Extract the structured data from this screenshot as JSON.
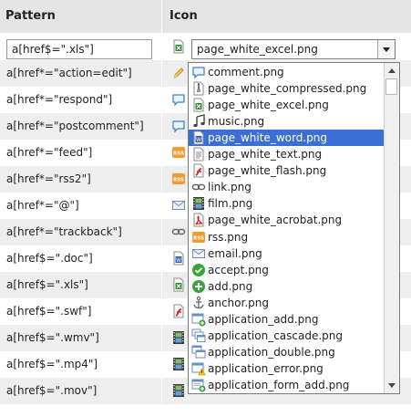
{
  "header": {
    "col1": "Pattern",
    "col2": "Icon"
  },
  "editor": {
    "pattern_value": "a[href$=\".xls\"]",
    "selected_icon": "page_white_excel.png",
    "selected_icon_name": "excel-icon"
  },
  "rows": [
    {
      "pattern": "a[href*=\"action=edit\"]",
      "icon": "pencil-icon"
    },
    {
      "pattern": "a[href*=\"respond\"]",
      "icon": "comment-icon"
    },
    {
      "pattern": "a[href*=\"postcomment\"]",
      "icon": "comment-icon"
    },
    {
      "pattern": "a[href*=\"feed\"]",
      "icon": "rss-icon"
    },
    {
      "pattern": "a[href*=\"rss2\"]",
      "icon": "rss-icon"
    },
    {
      "pattern": "a[href*=\"@\"]",
      "icon": "email-icon"
    },
    {
      "pattern": "a[href*=\"trackback\"]",
      "icon": "link-icon"
    },
    {
      "pattern": "a[href$=\".doc\"]",
      "icon": "word-icon"
    },
    {
      "pattern": "a[href$=\".xls\"]",
      "icon": "excel-icon"
    },
    {
      "pattern": "a[href$=\".swf\"]",
      "icon": "flash-icon"
    },
    {
      "pattern": "a[href$=\".wmv\"]",
      "icon": "film-icon"
    },
    {
      "pattern": "a[href$=\".mp4\"]",
      "icon": "film-icon"
    },
    {
      "pattern": "a[href$=\".mov\"]",
      "icon": "film-icon"
    }
  ],
  "dropdown": {
    "selected_index": 4,
    "items": [
      {
        "label": "comment.png",
        "icon": "comment-icon"
      },
      {
        "label": "page_white_compressed.png",
        "icon": "compressed-icon"
      },
      {
        "label": "page_white_excel.png",
        "icon": "excel-icon"
      },
      {
        "label": "music.png",
        "icon": "music-icon"
      },
      {
        "label": "page_white_word.png",
        "icon": "word-icon"
      },
      {
        "label": "page_white_text.png",
        "icon": "text-icon"
      },
      {
        "label": "page_white_flash.png",
        "icon": "flash-icon"
      },
      {
        "label": "link.png",
        "icon": "link-icon"
      },
      {
        "label": "film.png",
        "icon": "film-icon"
      },
      {
        "label": "page_white_acrobat.png",
        "icon": "acrobat-icon"
      },
      {
        "label": "rss.png",
        "icon": "rss-icon"
      },
      {
        "label": "email.png",
        "icon": "email-icon"
      },
      {
        "label": "accept.png",
        "icon": "accept-icon"
      },
      {
        "label": "add.png",
        "icon": "add-icon"
      },
      {
        "label": "anchor.png",
        "icon": "anchor-icon"
      },
      {
        "label": "application_add.png",
        "icon": "app-add-icon"
      },
      {
        "label": "application_cascade.png",
        "icon": "app-cascade-icon"
      },
      {
        "label": "application_double.png",
        "icon": "app-double-icon"
      },
      {
        "label": "application_error.png",
        "icon": "app-error-icon"
      },
      {
        "label": "application_form_add.png",
        "icon": "app-form-add-icon"
      }
    ]
  }
}
